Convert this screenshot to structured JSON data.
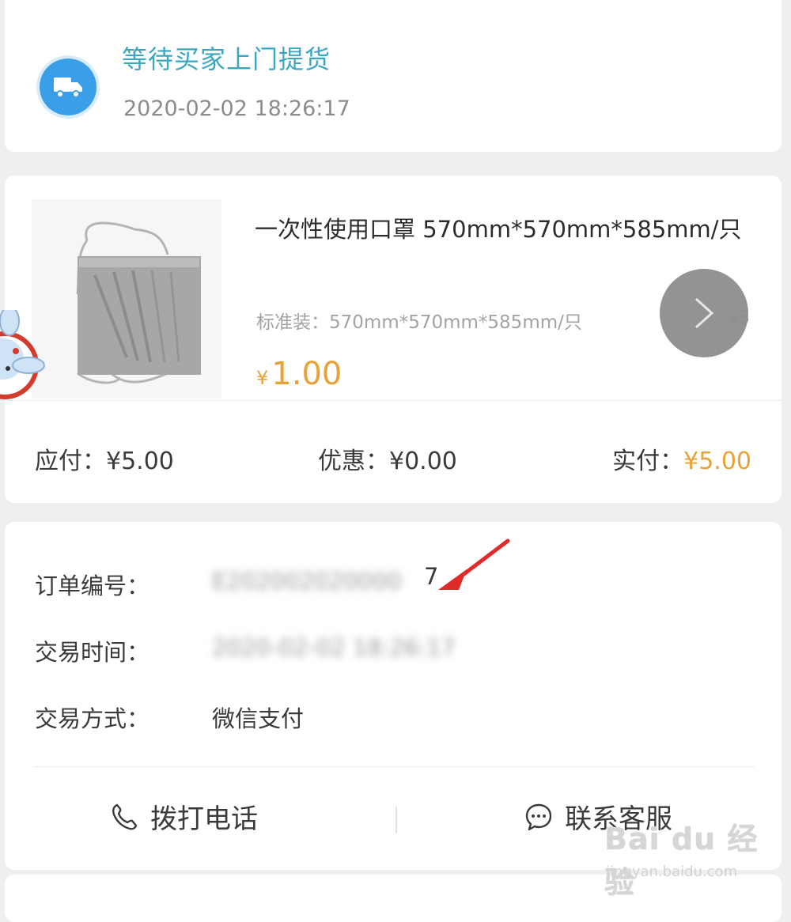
{
  "status": {
    "title": "等待买家上门提货",
    "time": "2020-02-02 18:26:17",
    "icon": "truck-icon"
  },
  "product": {
    "name": "一次性使用口罩 570mm*570mm*585mm/只",
    "spec": "标准装：570mm*570mm*585mm/只",
    "price_symbol": "¥",
    "price": "1.00",
    "qty": "x5"
  },
  "summary": {
    "payable_label": "应付：",
    "payable_value": "¥5.00",
    "discount_label": "优惠：",
    "discount_value": "¥0.00",
    "actual_label": "实付：",
    "actual_value": "¥5.00"
  },
  "order_info": {
    "order_no_label": "订单编号：",
    "order_no_value": "E202002020000",
    "order_no_tail": "7",
    "trade_time_label": "交易时间：",
    "trade_time_value": "2020-02-02 18:26:17",
    "trade_method_label": "交易方式：",
    "trade_method_value": "微信支付"
  },
  "actions": {
    "call_label": "拨打电话",
    "service_label": "联系客服"
  },
  "watermark": {
    "brand": "Bai du 经验",
    "url": "jingyan.baidu.com"
  },
  "colors": {
    "accent_price": "#e8a23a",
    "status_title": "#3aa7c2",
    "truck_badge": "#3a9fe8"
  }
}
